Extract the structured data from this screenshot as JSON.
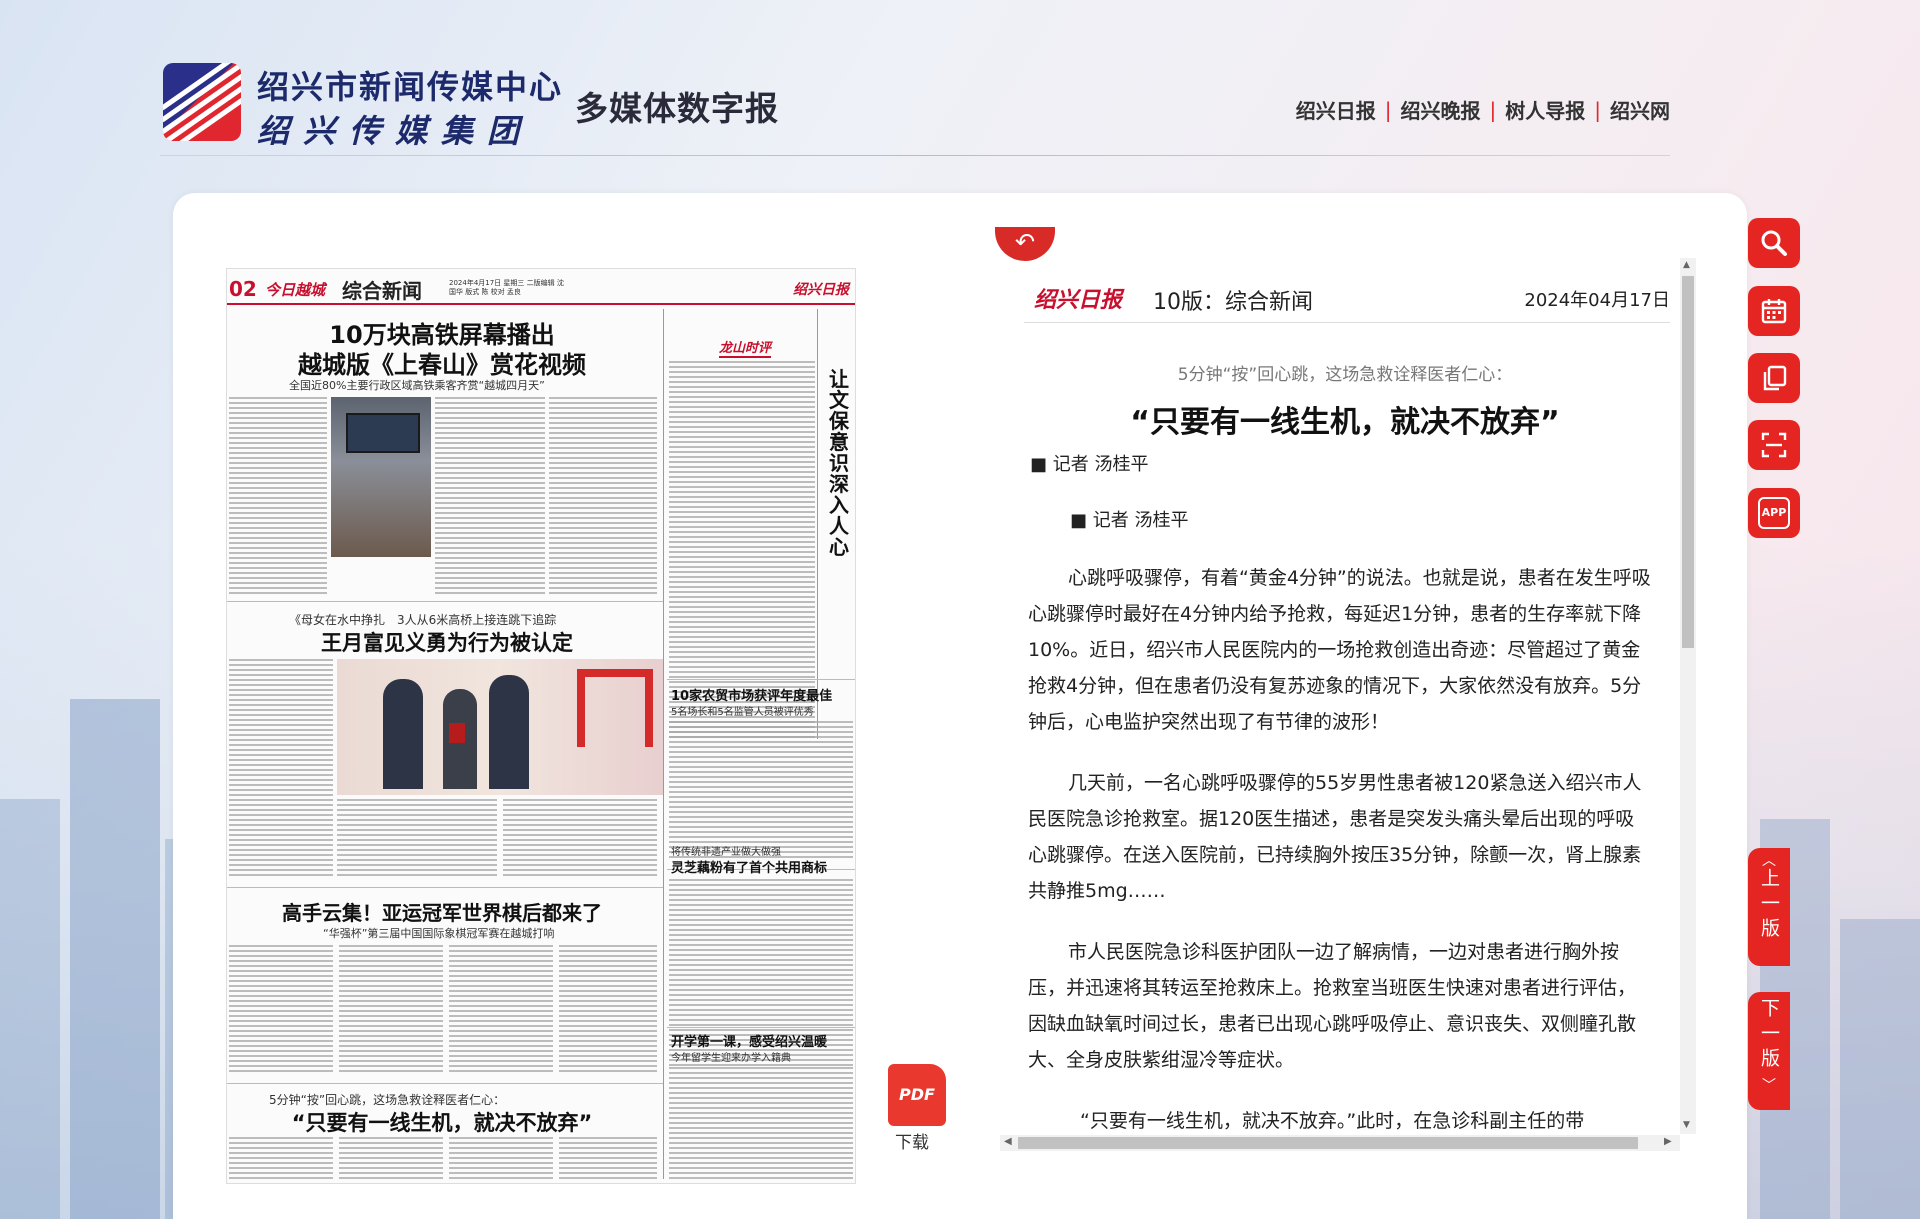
{
  "header": {
    "org_line1": "绍兴市新闻传媒中心",
    "org_line2": "绍兴传媒集团",
    "site_name": "多媒体数字报",
    "nav": [
      "绍兴日报",
      "绍兴晚报",
      "树人导报",
      "绍兴网"
    ],
    "nav_separator": "|"
  },
  "newspaper_page": {
    "page_number": "02",
    "brand": "今日越城",
    "section": "综合新闻",
    "meta": "2024年4月17日 星期三 二版编辑 沈国华 版式 陈 校对 孟良",
    "logo": "绍兴日报",
    "commentary_tag": "龙山时评",
    "vertical_title": "让文保意识深入人心",
    "headline1_line1": "10万块高铁屏幕播出",
    "headline1_line2": "越城版《上春山》赏花视频",
    "headline1_sub": "全国近80%主要行政区域高铁乘客齐赏“越城四月天”",
    "headline2_kicker": "《母女在水中挣扎　3人从6米高桥上接连跳下追踪",
    "headline2": "王月富见义勇为行为被认定",
    "headline3": "高手云集！亚运冠军世界棋后都来了",
    "headline3_sub": "“华强杯”第三届中国国际象棋冠军赛在越城打响",
    "headline4_kicker": "5分钟“按”回心跳，这场急救诠释医者仁心：",
    "headline4": "“只要有一线生机，就决不放弃”",
    "side1_title": "10家农贸市场获评年度最佳",
    "side1_sub": "5名场长和5名监管人员被评优秀",
    "side2_kicker": "将传统非遗产业做大做强",
    "side2_title": "灵芝藕粉有了首个共用商标",
    "side3_title": "开学第一课，感受绍兴温暖",
    "side3_sub": "今年留学生迎来办学入籍典"
  },
  "pdf_download": {
    "icon_text": "PDF",
    "label": "下载"
  },
  "article": {
    "paper_name": "绍兴日报",
    "edition": "10版：综合新闻",
    "date": "2024年04月17日",
    "subtitle": "5分钟“按”回心跳，这场急救诠释医者仁心：",
    "title": "“只要有一线生机，就决不放弃”",
    "author_line1": "■ 记者 汤桂平",
    "author_line2": "■ 记者 汤桂平",
    "paragraphs": [
      "心跳呼吸骤停，有着“黄金4分钟”的说法。也就是说，患者在发生呼吸心跳骤停时最好在4分钟内给予抢救，每延迟1分钟，患者的生存率就下降10%。近日，绍兴市人民医院内的一场抢救创造出奇迹：尽管超过了黄金抢救4分钟，但在患者仍没有复苏迹象的情况下，大家依然没有放弃。5分钟后，心电监护突然出现了有节律的波形！",
      "几天前，一名心跳呼吸骤停的55岁男性患者被120紧急送入绍兴市人民医院急诊抢救室。据120医生描述，患者是突发头痛头晕后出现的呼吸心跳骤停。在送入医院前，已持续胸外按压35分钟，除颤一次，肾上腺素共静推5mg……",
      "市人民医院急诊科医护团队一边了解病情，一边对患者进行胸外按压，并迅速将其转运至抢救床上。抢救室当班医生快速对患者进行评估，因缺血缺氧时间过长，患者已出现心跳呼吸停止、意识丧失、双侧瞳孔散大、全身皮肤紫绀湿冷等症状。",
      "“只要有一线生机，就决不放弃。”此时，在急诊科副主任的带"
    ]
  },
  "tools": [
    {
      "name": "search-icon"
    },
    {
      "name": "calendar-icon"
    },
    {
      "name": "copy-icon"
    },
    {
      "name": "scan-icon"
    },
    {
      "name": "app-icon",
      "text": "APP"
    }
  ],
  "pager": {
    "prev": "上一版",
    "next": "下一版"
  },
  "colors": {
    "brand_red": "#e52521",
    "brand_navy": "#1c2a6b"
  }
}
